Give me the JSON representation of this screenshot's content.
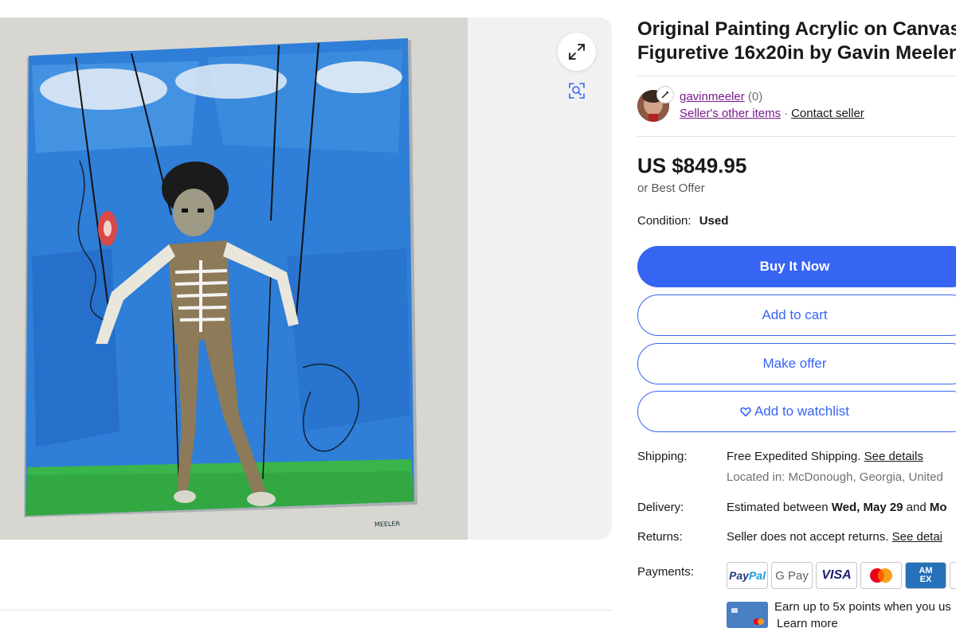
{
  "gallery": {
    "image_alt": "Acrylic painting of a marionette-like skeletal figure on strings against a blue background with green ground",
    "painting_signature": "MEELER",
    "expand_icon": "expand-arrows-icon",
    "visual_search_icon": "camera-search-icon"
  },
  "listing": {
    "title_line1": "Original Painting Acrylic on Canvas",
    "title_line2": "Figuretive 16x20in by Gavin Meeler"
  },
  "seller": {
    "name": "gavinmeeler",
    "feedback": "(0)",
    "other_items": "Seller's other items",
    "separator": "·",
    "contact": "Contact seller"
  },
  "price": {
    "amount": "US $849.95",
    "best_offer": "or Best Offer"
  },
  "condition": {
    "label": "Condition:",
    "value": "Used"
  },
  "actions": {
    "buy": "Buy It Now",
    "cart": "Add to cart",
    "offer": "Make offer",
    "watch": "Add to watchlist"
  },
  "shipping": {
    "label": "Shipping:",
    "free": "Free",
    "method": " Expedited Shipping. ",
    "details": "See details",
    "location": "Located in: McDonough, Georgia, United"
  },
  "delivery": {
    "label": "Delivery:",
    "text": "Estimated between ",
    "date1": "Wed, May 29",
    "and": " and ",
    "date2": "Mo"
  },
  "returns": {
    "label": "Returns:",
    "text": "Seller does not accept returns. ",
    "details": "See detai"
  },
  "payments": {
    "label": "Payments:",
    "paypal_a": "Pay",
    "paypal_b": "Pal",
    "gpay": "G Pay",
    "visa": "VISA",
    "amex_a": "AM",
    "amex_b": "EX",
    "earn": "Earn up to 5x points when you us",
    "learn": "Learn more"
  },
  "colors": {
    "primary": "#3665f3",
    "seller_link": "#7a1b8c",
    "text": "#191919",
    "muted": "#707070"
  }
}
